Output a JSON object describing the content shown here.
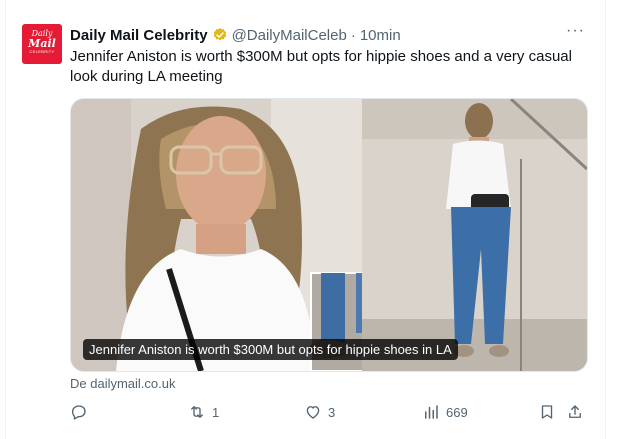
{
  "tweet": {
    "author_name": "Daily Mail Celebrity",
    "handle": "@DailyMailCeleb",
    "separator": "·",
    "time": "10min",
    "more": "···",
    "text": "Jennifer Aniston is worth $300M but opts for hippie shoes and a very casual look during LA meeting",
    "avatar": {
      "line1": "Daily",
      "line2": "Mail",
      "line3": "CELEBRITY"
    },
    "verified_color": "#E2B719"
  },
  "card": {
    "caption": "Jennifer Aniston is worth $300M but opts for hippie shoes in LA",
    "source": "De dailymail.co.uk"
  },
  "actions": {
    "reply_count": "",
    "retweet_count": "1",
    "like_count": "3",
    "views_count": "669"
  },
  "colors": {
    "brand": "#E51B35",
    "text": "#0F1419",
    "muted": "#536471"
  }
}
